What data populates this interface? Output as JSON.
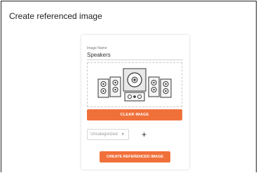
{
  "page": {
    "title": "Create referenced image"
  },
  "form": {
    "image_name_label": "Image Name",
    "image_name_value": "Speakers",
    "clear_button": "CLEAR IMAGE",
    "category_selected": "Uncategorized",
    "create_button": "CREATE REFERENCED IMAGE"
  },
  "icons": {
    "dropdown": "chevron-down-icon",
    "add": "plus-icon"
  },
  "colors": {
    "accent": "#f0703a"
  }
}
